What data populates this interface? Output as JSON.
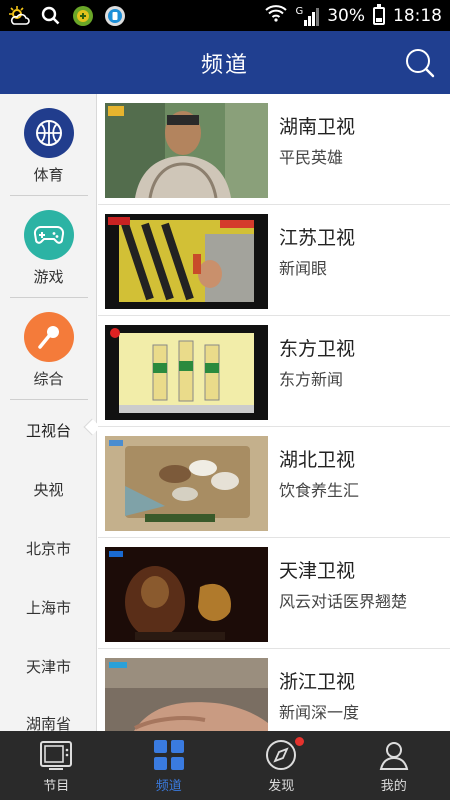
{
  "status_bar": {
    "icons": [
      "weather-icon",
      "search-icon",
      "game-app-icon",
      "app-icon",
      "wifi-icon",
      "signal-icon",
      "battery-icon"
    ],
    "network": "G",
    "battery": "30%",
    "time": "18:18"
  },
  "header": {
    "title": "频道",
    "search_icon": "search-icon",
    "color": "#203f90"
  },
  "sidebar": {
    "categories": [
      {
        "label": "体育",
        "icon": "basketball-icon",
        "color": "#213d8d"
      },
      {
        "label": "游戏",
        "icon": "gamepad-icon",
        "color": "#2cb3a4"
      },
      {
        "label": "综合",
        "icon": "microphone-icon",
        "color": "#f47b3a"
      }
    ],
    "regions": [
      "卫视台",
      "央视",
      "北京市",
      "上海市",
      "天津市",
      "湖南省"
    ],
    "selected_region": "卫视台"
  },
  "channels": [
    {
      "name": "湖南卫视",
      "program": "平民英雄"
    },
    {
      "name": "江苏卫视",
      "program": "新闻眼"
    },
    {
      "name": "东方卫视",
      "program": "东方新闻"
    },
    {
      "name": "湖北卫视",
      "program": "饮食养生汇"
    },
    {
      "name": "天津卫视",
      "program": "风云对话医界翘楚"
    },
    {
      "name": "浙江卫视",
      "program": "新闻深一度"
    }
  ],
  "bottom_nav": {
    "items": [
      {
        "label": "节目",
        "icon": "tv-icon"
      },
      {
        "label": "频道",
        "icon": "grid-icon"
      },
      {
        "label": "发现",
        "icon": "compass-icon"
      },
      {
        "label": "我的",
        "icon": "user-icon"
      }
    ],
    "active": "频道",
    "active_color": "#3a7be0"
  }
}
